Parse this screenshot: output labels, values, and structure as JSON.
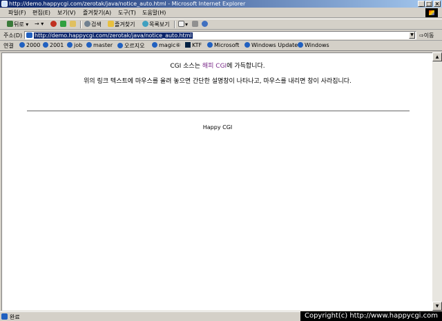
{
  "window": {
    "title": "http://demo.happycgi.com/zerotak/java/notice_auto.html - Microsoft Internet Explorer",
    "controls": {
      "minimize": "_",
      "maximize": "□",
      "close": "×"
    }
  },
  "menu": {
    "items": [
      "파일(F)",
      "편집(E)",
      "보기(V)",
      "즐겨찾기(A)",
      "도구(T)",
      "도움말(H)"
    ]
  },
  "toolbar": {
    "back": "뒤로",
    "forward": "→",
    "search": "검색",
    "favorites": "즐겨찾기",
    "history": "목록보기"
  },
  "address": {
    "label": "주소(D)",
    "url": "http://demo.happycgi.com/zerotak/java/notice_auto.html",
    "go": "이동"
  },
  "links": {
    "label": "연결",
    "items": [
      "2000",
      "2001",
      "job",
      "master",
      "오르지오",
      "magic⑥",
      "KTF",
      "Microsoft",
      "Windows Update",
      "Windows"
    ]
  },
  "content": {
    "line1_prefix": "CGI 소스는 ",
    "line1_link": "해피 CGI",
    "line1_suffix": "에 가득합니다.",
    "line2": "위의 링크 텍스트에 마우스를 올려 놓으면 간단한 설명창이 나타나고, 마우스를 내리면 창이 사라집니다.",
    "footer": "Happy CGI"
  },
  "status": {
    "text": "완료"
  },
  "overlay": {
    "copyright": "Copyright(c) http://www.happycgi.com"
  },
  "colors": {
    "titlebar": "#0a246a",
    "link_visited": "#7b2a8a"
  }
}
